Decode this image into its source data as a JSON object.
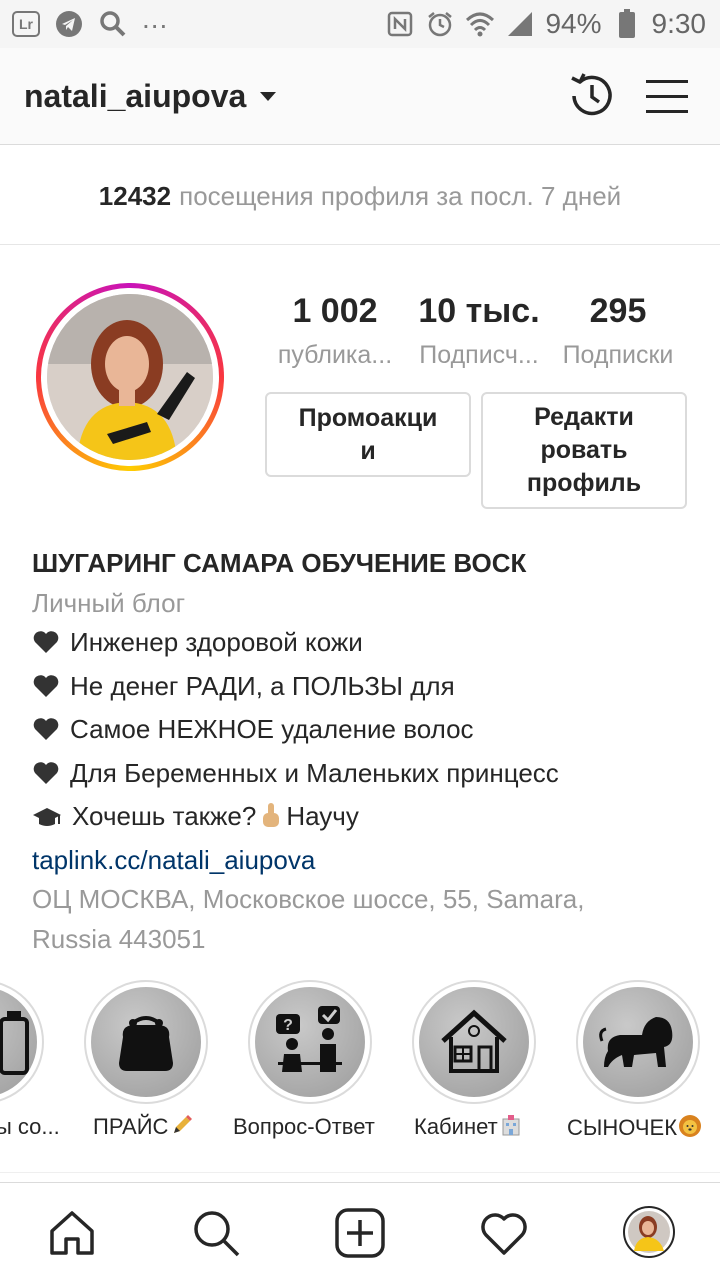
{
  "status_bar": {
    "battery": "94%",
    "time": "9:30",
    "dots": "...",
    "lr_label": "Lr"
  },
  "header": {
    "username": "natali_aiupova"
  },
  "visits": {
    "count": "12432",
    "text": "посещения профиля за посл. 7 дней"
  },
  "stats": [
    {
      "value": "1 002",
      "label": "публика..."
    },
    {
      "value": "10 тыс.",
      "label": "Подписч..."
    },
    {
      "value": "295",
      "label": "Подписки"
    }
  ],
  "buttons": {
    "promo_line1": "Промоакци",
    "promo_line2": "и",
    "edit_line1": "Редакти",
    "edit_line2": "ровать",
    "edit_line3": "профиль"
  },
  "bio": {
    "name": "ШУГАРИНГ САМАРА ОБУЧЕНИЕ ВОСК",
    "category": "Личный блог",
    "lines": [
      "Инженер здоровой кожи",
      "Не денег РАДИ, а ПОЛЬЗЫ для",
      "Самое НЕЖНОЕ удаление волос",
      "Для Беременных и Маленьких принцесс"
    ],
    "last_line_a": "Хочешь также?",
    "last_line_b": "Научу",
    "link": "taplink.cc/natali_aiupova",
    "address_line1": "ОЦ МОСКВА, Московское шоссе, 55, Samara,",
    "address_line2": "Russia 443051"
  },
  "highlights": [
    {
      "label": "ы со..."
    },
    {
      "label": "ПРАЙС"
    },
    {
      "label": "Вопрос-Ответ"
    },
    {
      "label": "Кабинет"
    },
    {
      "label": "СЫНОЧЕК"
    }
  ],
  "colors": {
    "link": "#003569",
    "muted": "#999999",
    "ring_gradient": [
      "#c913b9",
      "#f9373f",
      "#fecd00"
    ]
  },
  "icons": [
    "lightroom-icon",
    "telegram-icon",
    "search-icon",
    "nfc-icon",
    "alarm-icon",
    "wifi-icon",
    "signal-icon",
    "battery-icon",
    "history-icon",
    "menu-icon",
    "home-icon",
    "search-icon",
    "add-post-icon",
    "heart-icon",
    "profile-avatar-icon"
  ]
}
